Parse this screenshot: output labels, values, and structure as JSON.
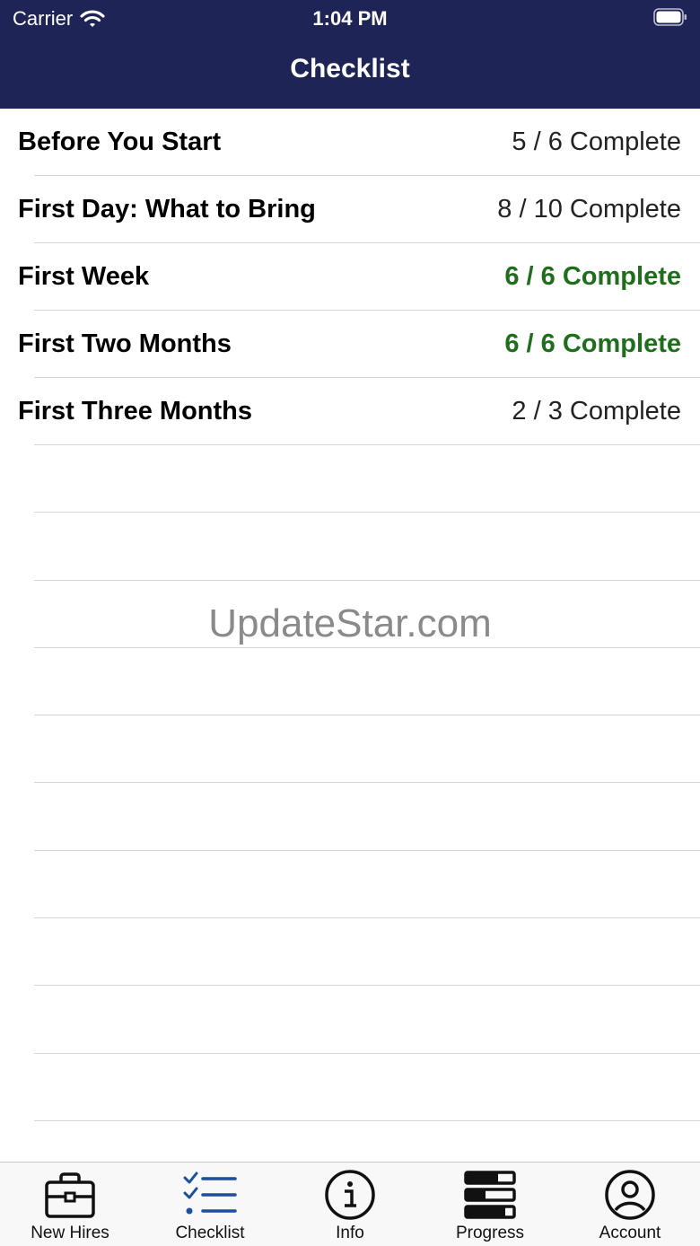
{
  "status_bar": {
    "carrier": "Carrier",
    "time": "1:04 PM"
  },
  "nav": {
    "title": "Checklist"
  },
  "rows": [
    {
      "title": "Before You Start",
      "status": "5 / 6 Complete",
      "complete": false
    },
    {
      "title": "First Day: What to Bring",
      "status": "8 / 10 Complete",
      "complete": false
    },
    {
      "title": "First Week",
      "status": "6 / 6 Complete",
      "complete": true
    },
    {
      "title": "First Two Months",
      "status": "6 / 6 Complete",
      "complete": true
    },
    {
      "title": "First Three Months",
      "status": "2 / 3 Complete",
      "complete": false
    }
  ],
  "watermark": "UpdateStar.com",
  "tabs": [
    {
      "label": "New Hires",
      "icon": "briefcase-icon"
    },
    {
      "label": "Checklist",
      "icon": "checklist-icon",
      "selected": true
    },
    {
      "label": "Info",
      "icon": "info-icon"
    },
    {
      "label": "Progress",
      "icon": "progress-icon"
    },
    {
      "label": "Account",
      "icon": "account-icon"
    }
  ],
  "colors": {
    "nav_bg": "#1e2456",
    "complete_green": "#1e6e1c",
    "tab_selected": "#1d4ea0"
  }
}
